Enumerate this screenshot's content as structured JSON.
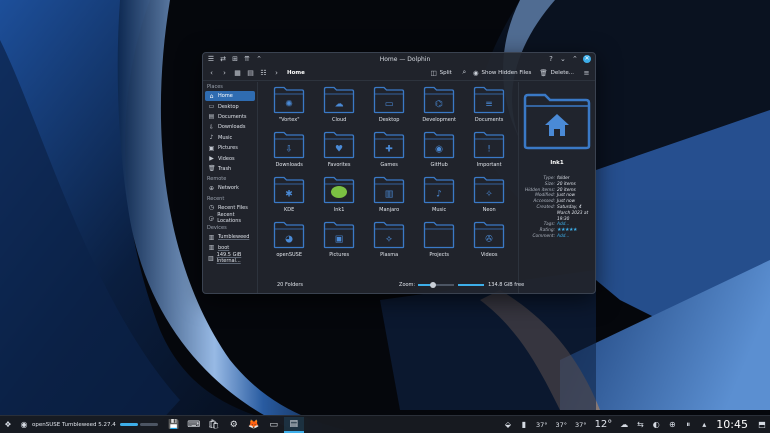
{
  "window": {
    "title": "Home — Dolphin",
    "breadcrumb": "Home",
    "split_label": "Split",
    "hidden_files_label": "Show Hidden Files",
    "delete_label": "Delete..."
  },
  "sidebar": {
    "sections": [
      {
        "heading": "Places",
        "items": [
          {
            "label": "Home",
            "icon": "home-icon",
            "active": true
          },
          {
            "label": "Desktop",
            "icon": "desktop-icon"
          },
          {
            "label": "Documents",
            "icon": "documents-icon"
          },
          {
            "label": "Downloads",
            "icon": "downloads-icon"
          },
          {
            "label": "Music",
            "icon": "music-icon"
          },
          {
            "label": "Pictures",
            "icon": "pictures-icon"
          },
          {
            "label": "Videos",
            "icon": "videos-icon"
          },
          {
            "label": "Trash",
            "icon": "trash-icon"
          }
        ]
      },
      {
        "heading": "Remote",
        "items": [
          {
            "label": "Network",
            "icon": "network-icon"
          }
        ]
      },
      {
        "heading": "Recent",
        "items": [
          {
            "label": "Recent Files",
            "icon": "recent-files-icon"
          },
          {
            "label": "Recent Locations",
            "icon": "recent-locations-icon"
          }
        ]
      },
      {
        "heading": "Devices",
        "items": [
          {
            "label": "Tumbleweed",
            "icon": "drive-icon"
          },
          {
            "label": "boot",
            "icon": "drive-icon"
          },
          {
            "label": "149.5 GiB Internal...",
            "icon": "drive-icon"
          }
        ]
      }
    ]
  },
  "folders": [
    {
      "label": "\"Vortex\"",
      "icon": "gear-icon"
    },
    {
      "label": "Cloud",
      "icon": "cloud-icon"
    },
    {
      "label": "Desktop",
      "icon": "desktop-icon"
    },
    {
      "label": "Development",
      "icon": "dev-icon"
    },
    {
      "label": "Documents",
      "icon": "document-icon"
    },
    {
      "label": "Downloads",
      "icon": "download-icon"
    },
    {
      "label": "Favorites",
      "icon": "heart-icon"
    },
    {
      "label": "Games",
      "icon": "gamepad-icon"
    },
    {
      "label": "GitHub",
      "icon": "github-icon"
    },
    {
      "label": "Important",
      "icon": "exclamation-icon"
    },
    {
      "label": "KDE",
      "icon": "kde-icon"
    },
    {
      "label": "lnk1",
      "icon": "chameleon-icon"
    },
    {
      "label": "Manjaro",
      "icon": "manjaro-icon"
    },
    {
      "label": "Music",
      "icon": "music-note-icon"
    },
    {
      "label": "Neon",
      "icon": "neon-icon"
    },
    {
      "label": "openSUSE",
      "icon": "opensuse-icon"
    },
    {
      "label": "Pictures",
      "icon": "picture-icon"
    },
    {
      "label": "Plasma",
      "icon": "plasma-icon"
    },
    {
      "label": "Projects",
      "icon": "folder-icon"
    },
    {
      "label": "Videos",
      "icon": "film-icon"
    }
  ],
  "info": {
    "name": "lnk1",
    "rows": [
      {
        "k": "Type:",
        "v": "folder"
      },
      {
        "k": "Size:",
        "v": "20 items"
      },
      {
        "k": "Hidden items:",
        "v": "20 items"
      },
      {
        "k": "Modified:",
        "v": "Just now"
      },
      {
        "k": "Accessed:",
        "v": "Just now"
      },
      {
        "k": "Created:",
        "v": "Saturday, 4 March 2023 at 19:30"
      },
      {
        "k": "Tags:",
        "v": "Add..."
      },
      {
        "k": "Rating:",
        "v": "★★★★★"
      },
      {
        "k": "Comment:",
        "v": "Add..."
      }
    ]
  },
  "status": {
    "folder_count": "20 Folders",
    "zoom_label": "Zoom:",
    "zoom_level": 0.4,
    "free_space": "134.8 GiB free"
  },
  "panel": {
    "session_label": "openSUSE Tumbleweed 5.27.4",
    "temps": [
      "37°",
      "37°",
      "37°"
    ],
    "weather_temp": "12°",
    "clock": "10:45"
  },
  "colors": {
    "accent": "#3daee9",
    "folder": "#3a79c6",
    "selection": "#2f6cb1"
  }
}
